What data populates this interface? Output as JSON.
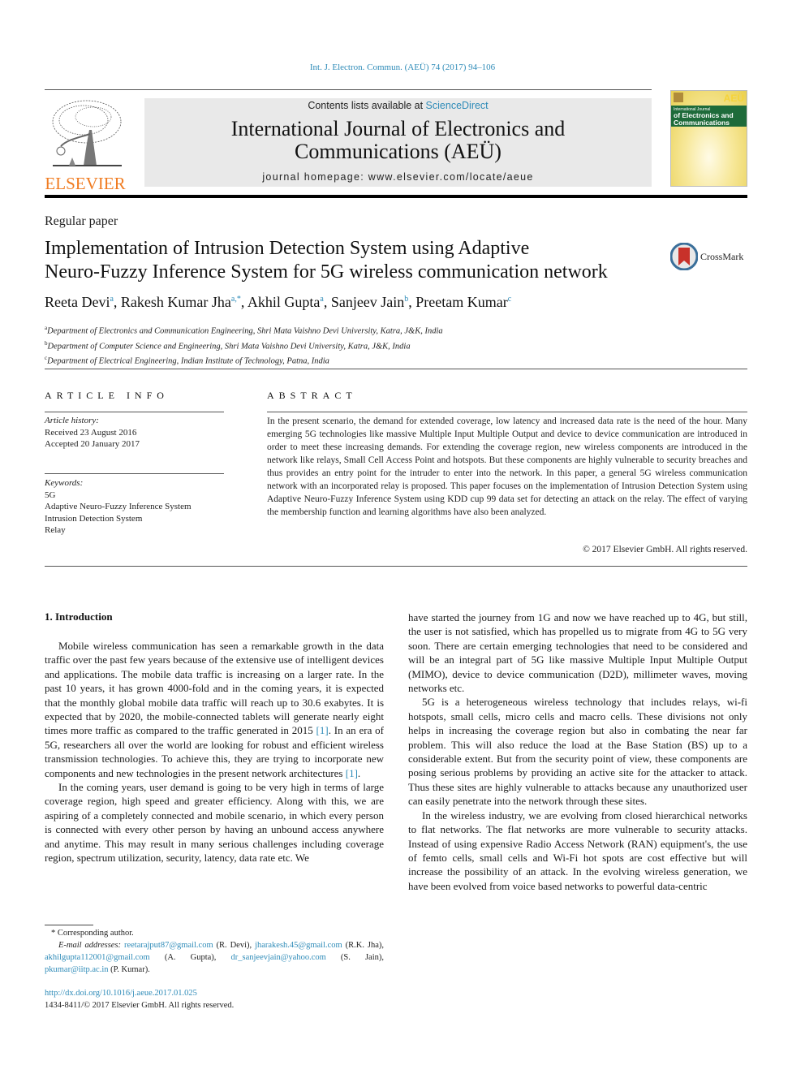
{
  "citation": "Int. J. Electron. Commun. (AEÜ) 74 (2017) 94–106",
  "header": {
    "publisher_logo_text": "ELSEVIER",
    "contents_prefix": "Contents lists available at ",
    "contents_link": "ScienceDirect",
    "journal_title_line1": "International Journal of Electronics and",
    "journal_title_line2": "Communications (AEÜ)",
    "homepage_prefix": "journal homepage: ",
    "homepage_url": "www.elsevier.com/locate/aeue",
    "cover": {
      "small_title": "International Journal",
      "title_line1": "of Electronics and",
      "title_line2": "Communications",
      "badge": "AEÜ"
    },
    "colors": {
      "publisher_orange": "#f07c22",
      "link_blue": "#2e8bb8",
      "cover_green": "#1e6b3a"
    }
  },
  "article": {
    "type": "Regular paper",
    "title_line1": "Implementation of Intrusion Detection System using Adaptive",
    "title_line2": "Neuro-Fuzzy Inference System for 5G wireless communication network",
    "crossmark_label": "CrossMark",
    "authors": [
      {
        "name": "Reeta Devi",
        "sup": "a",
        "sep": ", "
      },
      {
        "name": "Rakesh Kumar Jha",
        "sup": "a,*",
        "sep": ", "
      },
      {
        "name": "Akhil Gupta",
        "sup": "a",
        "sep": ", "
      },
      {
        "name": "Sanjeev Jain",
        "sup": "b",
        "sep": ", "
      },
      {
        "name": "Preetam Kumar",
        "sup": "c",
        "sep": ""
      }
    ],
    "affiliations": [
      {
        "sup": "a",
        "text": "Department of Electronics and Communication Engineering, Shri Mata Vaishno Devi University, Katra, J&K, India"
      },
      {
        "sup": "b",
        "text": "Department of Computer Science and Engineering, Shri Mata Vaishno Devi University, Katra, J&K, India"
      },
      {
        "sup": "c",
        "text": "Department of Electrical Engineering, Indian Institute of Technology, Patna, India"
      }
    ]
  },
  "article_info": {
    "heading": "ARTICLE INFO",
    "history_label": "Article history:",
    "received": "Received 23 August 2016",
    "accepted": "Accepted 20 January 2017",
    "keywords_label": "Keywords:",
    "keywords": [
      "5G",
      "Adaptive Neuro-Fuzzy Inference System",
      "Intrusion Detection System",
      "Relay"
    ]
  },
  "abstract": {
    "heading": "ABSTRACT",
    "text": "In the present scenario, the demand for extended coverage, low latency and increased data rate is the need of the hour. Many emerging 5G technologies like massive Multiple Input Multiple Output and device to device communication are introduced in order to meet these increasing demands. For extending the coverage region, new wireless components are introduced in the network like relays, Small Cell Access Point and hotspots. But these components are highly vulnerable to security breaches and thus provides an entry point for the intruder to enter into the network. In this paper, a general 5G wireless communication network with an incorporated relay is proposed. This paper focuses on the implementation of Intrusion Detection System using Adaptive Neuro-Fuzzy Inference System using KDD cup 99 data set for detecting an attack on the relay. The effect of varying the membership function and learning algorithms have also been analyzed.",
    "copyright": "© 2017 Elsevier GmbH. All rights reserved."
  },
  "body": {
    "section_heading": "1. Introduction",
    "left_p1_a": "Mobile wireless communication has seen a remarkable growth in the data traffic over the past few years because of the extensive use of intelligent devices and applications. The mobile data traffic is increasing on a larger rate. In the past 10 years, it has grown 4000-fold and in the coming years, it is expected that the monthly global mobile data traffic will reach up to 30.6 exabytes. It is expected that by 2020, the mobile-connected tablets will generate nearly eight times more traffic as compared to the traffic generated in 2015 ",
    "ref1": "[1]",
    "left_p1_b": ". In an era of 5G, researchers all over the world are looking for robust and efficient wireless transmission technologies. To achieve this, they are trying to incorporate new components and new technologies in the present network architectures ",
    "left_p1_c": ".",
    "left_p2": "In the coming years, user demand is going to be very high in terms of large coverage region, high speed and greater efficiency. Along with this, we are aspiring of a completely connected and mobile scenario, in which every person is connected with every other person by having an unbound access anywhere and anytime. This may result in many serious challenges including coverage region, spectrum utilization, security, latency, data rate etc. We",
    "right_p1": "have started the journey from 1G and now we have reached up to 4G, but still, the user is not satisfied, which has propelled us to migrate from 4G to 5G very soon. There are certain emerging technologies that need to be considered and will be an integral part of 5G like massive Multiple Input Multiple Output (MIMO), device to device communication (D2D), millimeter waves, moving networks etc.",
    "right_p2": "5G is a heterogeneous wireless technology that includes relays, wi-fi hotspots, small cells, micro cells and macro cells. These divisions not only helps in increasing the coverage region but also in combating the near far problem. This will also reduce the load at the Base Station (BS) up to a considerable extent. But from the security point of view, these components are posing serious problems by providing an active site for the attacker to attack. Thus these sites are highly vulnerable to attacks because any unauthorized user can easily penetrate into the network through these sites.",
    "right_p3": "In the wireless industry, we are evolving from closed hierarchical networks to flat networks. The flat networks are more vulnerable to security attacks. Instead of using expensive Radio Access Network (RAN) equipment's, the use of femto cells, small cells and Wi-Fi hot spots are cost effective but will increase the possibility of an attack. In the evolving wireless generation, we have been evolved from voice based networks to powerful data-centric"
  },
  "footnotes": {
    "corresponding": "* Corresponding author.",
    "email_label": "E-mail addresses:",
    "emails": [
      {
        "address": "reetarajput87@gmail.com",
        "who": " (R. Devi), "
      },
      {
        "address": "jharakesh.45@gmail.com",
        "who": " (R.K. Jha), "
      },
      {
        "address": "akhilgupta112001@gmail.com",
        "who": " (A. Gupta), "
      },
      {
        "address": "dr_sanjeevjain@yahoo.com",
        "who": " (S. Jain), "
      },
      {
        "address": "pkumar@iitp.ac.in",
        "who": " (P. Kumar)."
      }
    ],
    "doi": "http://dx.doi.org/10.1016/j.aeue.2017.01.025",
    "issn_copyright": "1434-8411/© 2017 Elsevier GmbH. All rights reserved."
  }
}
